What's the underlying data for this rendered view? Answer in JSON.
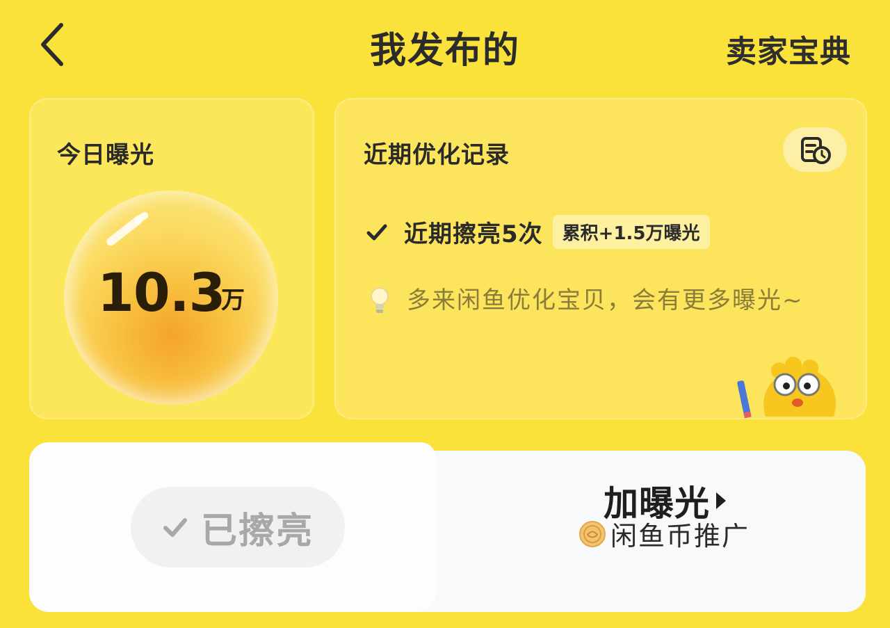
{
  "header": {
    "title": "我发布的",
    "right_link": "卖家宝典"
  },
  "today_card": {
    "label": "今日曝光",
    "value": "10.3",
    "unit": "万"
  },
  "record_card": {
    "title": "近期优化记录",
    "polish_text": "近期擦亮5次",
    "polish_tag": "累积+1.5万曝光",
    "tip": "多来闲鱼优化宝贝，会有更多曝光~"
  },
  "actions": {
    "polished_label": "已擦亮",
    "boost_label": "加曝光",
    "coin_label": "闲鱼币推广"
  },
  "colors": {
    "background": "#fbe23a",
    "card": "#fce55c",
    "accent": "#f4a42a"
  },
  "icons": [
    "back-arrow-icon",
    "history-record-icon",
    "checkmark-icon",
    "lightbulb-icon",
    "mascot-icon",
    "play-arrow-icon",
    "coin-icon"
  ]
}
